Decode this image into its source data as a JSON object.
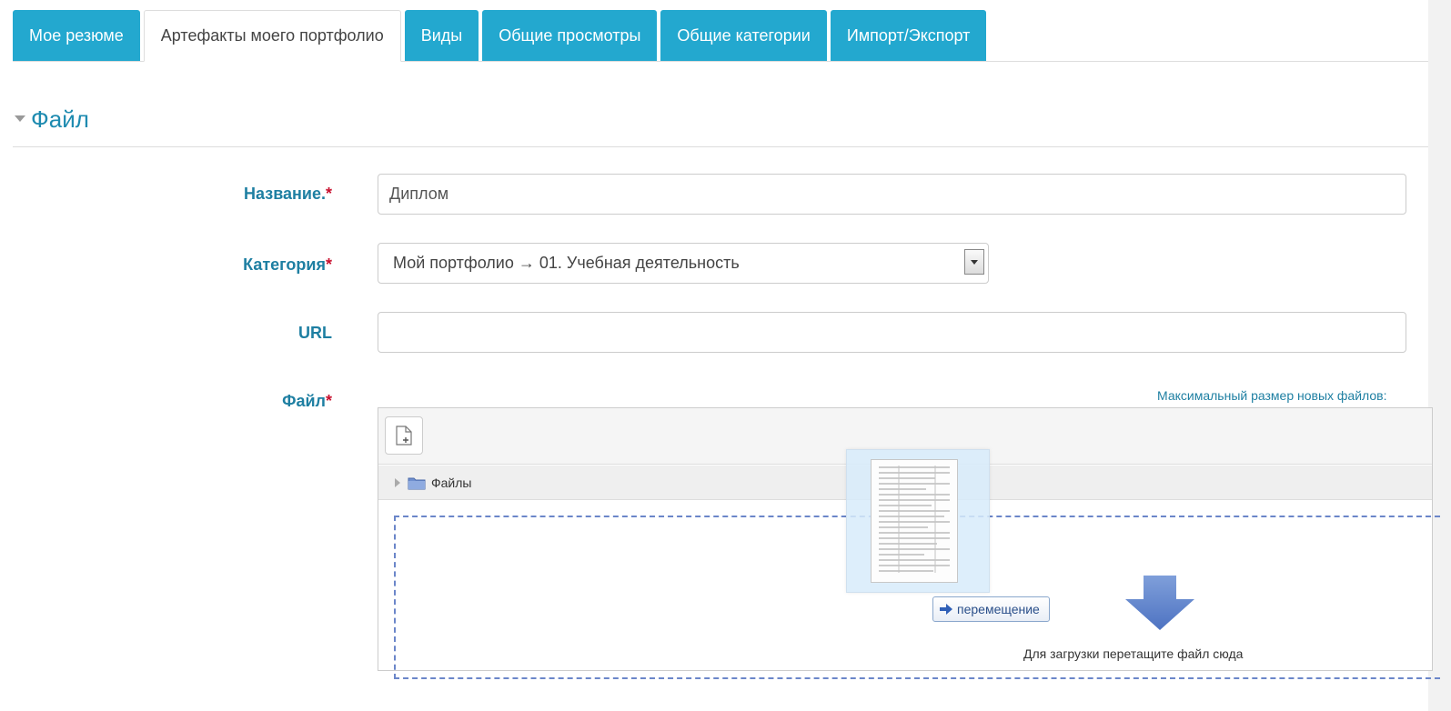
{
  "tabs": [
    {
      "label": "Мое резюме",
      "active": false
    },
    {
      "label": "Артефакты моего портфолио",
      "active": true
    },
    {
      "label": "Виды",
      "active": false
    },
    {
      "label": "Общие просмотры",
      "active": false
    },
    {
      "label": "Общие категории",
      "active": false
    },
    {
      "label": "Импорт/Экспорт",
      "active": false
    }
  ],
  "section": {
    "title": "Файл"
  },
  "form": {
    "name_label": "Название.",
    "name_value": "Диплом",
    "category_label": "Категория",
    "category_value": "Мой портфолио → 01. Учебная деятельность",
    "url_label": "URL",
    "url_value": "",
    "file_label": "Файл",
    "required_mark": "*",
    "max_size_label": "Максимальный размер новых файлов:"
  },
  "file_manager": {
    "path_folder": "Файлы",
    "drop_text": "Для загрузки перетащите файл сюда",
    "drag_action": "перемещение"
  },
  "colors": {
    "tab_bg": "#23a8cf",
    "label": "#1e7fa2",
    "required": "#c8102e",
    "dashed_border": "#6b86c9"
  }
}
